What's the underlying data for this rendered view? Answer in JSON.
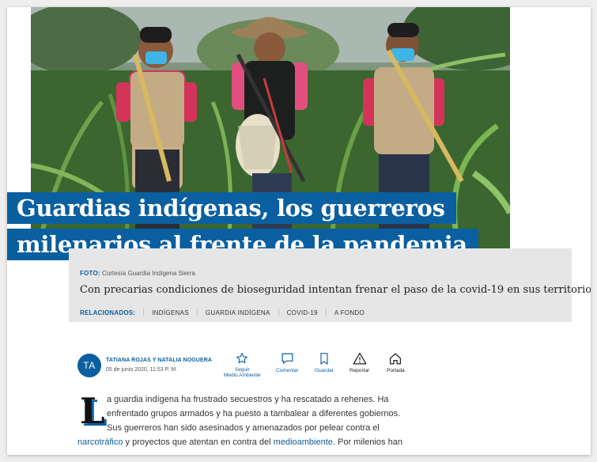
{
  "article": {
    "headline_line1": "Guardias indígenas, los guerreros",
    "headline_line2": "milenarios al frente de la pandemia",
    "photo_credit_label": "FOTO:",
    "photo_credit_text": "Cortesía Guardia Indígena Sierra",
    "subtitle": "Con precarias condiciones de bioseguridad intentan frenar el paso de la covid-19 en sus territorios.",
    "related_label": "RELACIONADOS:",
    "related_tags": [
      "INDÍGENAS",
      "GUARDIA INDÍGENA",
      "COVID-19",
      "A FONDO"
    ]
  },
  "byline": {
    "avatar_initials": "TA",
    "authors": "TATIANA ROJAS Y NATALIA NOGUERA",
    "date": "05 de junio 2020, 11:53 P. M."
  },
  "actions": {
    "follow_line1": "Seguir",
    "follow_line2": "Medio Ambiente",
    "comment": "Comentar",
    "save": "Guardar",
    "report": "Reportar",
    "home": "Portada"
  },
  "body": {
    "dropcap": "L",
    "line1": "a guardia indígena ha frustrado secuestros y ha rescatado a rehenes. Ha",
    "line2": "enfrentado grupos armados y ha puesto a tambalear a diferentes gobiernos.",
    "line3": "Sus guerreros han sido asesinados y amenazados por pelear contra el",
    "line4_link1": "narcotráfico",
    "line4_mid": " y proyectos que atentan en contra del ",
    "line4_link2": "medioambiente",
    "line4_end": ". Por milenios han"
  },
  "colors": {
    "brand_blue": "#0a5fa0",
    "caption_bg": "#e6e6e6"
  }
}
